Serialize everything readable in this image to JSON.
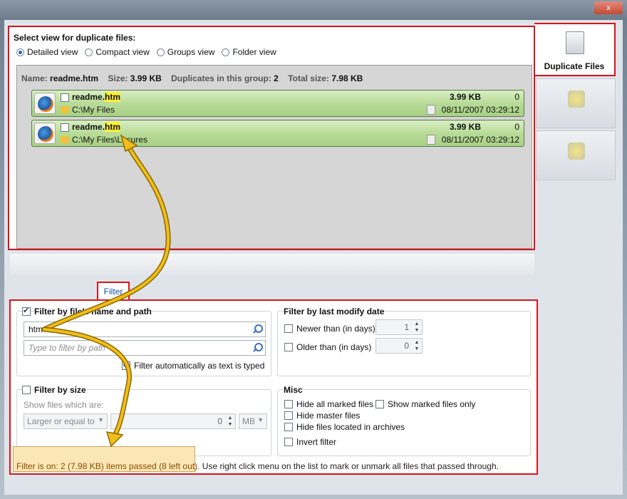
{
  "window": {
    "close_label": "x"
  },
  "view_panel": {
    "title": "Select view for duplicate files:",
    "views": [
      {
        "label": "Detailed view",
        "selected": true
      },
      {
        "label": "Compact view",
        "selected": false
      },
      {
        "label": "Groups view",
        "selected": false
      },
      {
        "label": "Folder view",
        "selected": false
      }
    ]
  },
  "group": {
    "name_label": "Name:",
    "name_value": "readme.htm",
    "size_label": "Size:",
    "size_value": "3.99 KB",
    "dups_label": "Duplicates in this group:",
    "dups_value": "2",
    "total_label": "Total size:",
    "total_value": "7.98 KB"
  },
  "files": [
    {
      "name_base": "readme.",
      "name_hl": "htm",
      "path": "C:\\My Files",
      "size": "3.99 KB",
      "count": "0",
      "date": "08/11/2007 03:29:12"
    },
    {
      "name_base": "readme.",
      "name_hl": "htm",
      "path": "C:\\My Files\\Lesures",
      "size": "3.99 KB",
      "count": "0",
      "date": "08/11/2007 03:29:12"
    }
  ],
  "side_tabs": {
    "duplicate_files": "Duplicate Files"
  },
  "filter_tab": {
    "label": "Filter"
  },
  "filter_name": {
    "title": "Filter by file's name and path",
    "input_value": "htm",
    "path_placeholder": "Type to filter by path",
    "auto_label": "Filter automatically as text is typed"
  },
  "filter_date": {
    "title": "Filter by last modify date",
    "newer_label": "Newer than (in days)",
    "newer_value": "1",
    "older_label": "Older than (in days)",
    "older_value": "0"
  },
  "filter_size": {
    "title": "Filter by size",
    "show_label": "Show files which are:",
    "compare_value": "Larger or equal to",
    "size_value": "0",
    "unit_value": "MB"
  },
  "misc": {
    "title": "Misc",
    "hide_marked": "Hide all marked files",
    "show_marked": "Show marked files only",
    "hide_master": "Hide master files",
    "hide_archives": "Hide files located in archives",
    "invert": "Invert filter"
  },
  "status": {
    "highlight": "Filter is on: 2 (7.98 KB) items passed (8 left out).",
    "rest": " Use right click menu on the list to mark or unmark all files that passed through."
  },
  "colors": {
    "accent_red": "#d8141c",
    "row_green": "#b8dc98",
    "highlight": "#ffef37",
    "arrow": "#f1bd1a"
  }
}
